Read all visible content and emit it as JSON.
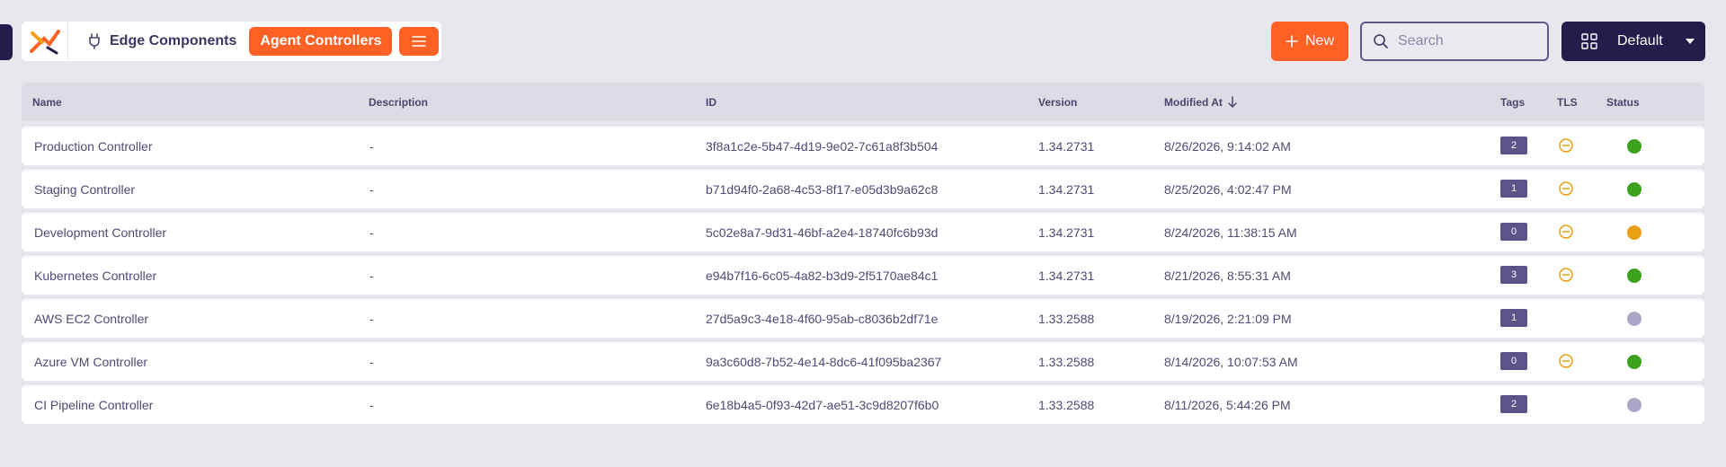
{
  "breadcrumb": {
    "section": "Edge Components",
    "active": "Agent Controllers"
  },
  "toolbar": {
    "new_label": "New",
    "search_placeholder": "Search",
    "view_label": "Default"
  },
  "table": {
    "columns": {
      "name": "Name",
      "description": "Description",
      "id": "ID",
      "version": "Version",
      "modified": "Modified At",
      "tags": "Tags",
      "tls": "TLS",
      "status": "Status"
    },
    "rows": [
      {
        "name": "Production Controller",
        "description": "-",
        "id": "3f8a1c2e-5b47-4d19-9e02-7c61a8f3b504",
        "version": "1.34.2731",
        "modified": "8/26/2026, 9:14:02 AM",
        "tags": "2",
        "tls": true,
        "status_color": "#3ba11a"
      },
      {
        "name": "Staging Controller",
        "description": "-",
        "id": "b71d94f0-2a68-4c53-8f17-e05d3b9a62c8",
        "version": "1.34.2731",
        "modified": "8/25/2026, 4:02:47 PM",
        "tags": "1",
        "tls": true,
        "status_color": "#3ba11a"
      },
      {
        "name": "Development Controller",
        "description": "-",
        "id": "5c02e8a7-9d31-46bf-a2e4-18740fc6b93d",
        "version": "1.34.2731",
        "modified": "8/24/2026, 11:38:15 AM",
        "tags": "0",
        "tls": true,
        "status_color": "#e8a010"
      },
      {
        "name": "Kubernetes Controller",
        "description": "-",
        "id": "e94b7f16-6c05-4a82-b3d9-2f5170ae84c1",
        "version": "1.34.2731",
        "modified": "8/21/2026, 8:55:31 AM",
        "tags": "3",
        "tls": true,
        "status_color": "#3ba11a"
      },
      {
        "name": "AWS EC2 Controller",
        "description": "-",
        "id": "27d5a9c3-4e18-4f60-95ab-c8036b2df71e",
        "version": "1.33.2588",
        "modified": "8/19/2026, 2:21:09 PM",
        "tags": "1",
        "tls": false,
        "status_color": "#a9a6c6"
      },
      {
        "name": "Azure VM Controller",
        "description": "-",
        "id": "9a3c60d8-7b52-4e14-8dc6-41f095ba2367",
        "version": "1.33.2588",
        "modified": "8/14/2026, 10:07:53 AM",
        "tags": "0",
        "tls": true,
        "status_color": "#3ba11a"
      },
      {
        "name": "CI Pipeline Controller",
        "description": "-",
        "id": "6e18b4a5-0f93-42d7-ae51-3c9d8207f6b0",
        "version": "1.33.2588",
        "modified": "8/11/2026, 5:44:26 PM",
        "tags": "2",
        "tls": false,
        "status_color": "#a9a6c6"
      }
    ]
  },
  "colors": {
    "accent": "#ff6024",
    "dark": "#231d4b",
    "tls_warning": "#e8a010"
  }
}
